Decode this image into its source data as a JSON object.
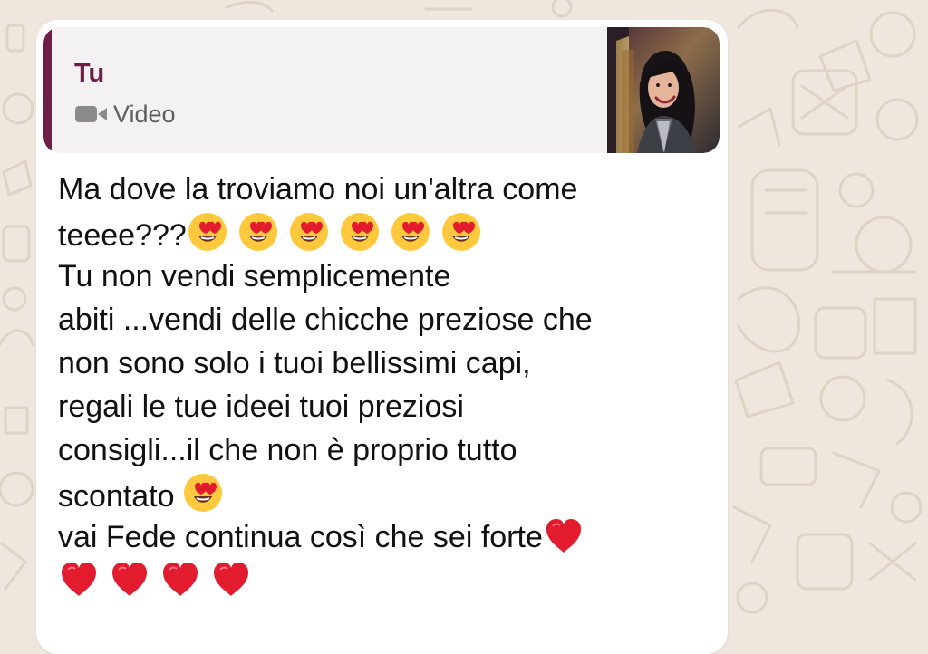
{
  "quote": {
    "author": "Tu",
    "media_label": "Video",
    "media_icon": "video-camera-icon",
    "thumbnail": "video-thumbnail-woman-portrait"
  },
  "message": {
    "line1": "Ma dove la troviamo noi un'altra come",
    "line2_text": "teeee???",
    "line2_emoji_count": 6,
    "line3": "Tu non vendi semplicemente",
    "line4": "abiti ...vendi delle chicche preziose che",
    "line5": "non sono solo i tuoi bellissimi capi,",
    "line6": "regali le tue ideei tuoi preziosi",
    "line7": "consigli...il che non è proprio tutto",
    "line8_text": "scontato",
    "line8_emoji_count": 1,
    "line9_text": "vai Fede continua così che sei forte",
    "line9_heart_count": 1,
    "line10_heart_count": 4
  },
  "colors": {
    "quote_accent": "#6e1f46",
    "bubble": "#ffffff",
    "wallpaper": "#efe7dd",
    "heart": "#e31b2f",
    "emoji_face": "#ffc83d"
  }
}
